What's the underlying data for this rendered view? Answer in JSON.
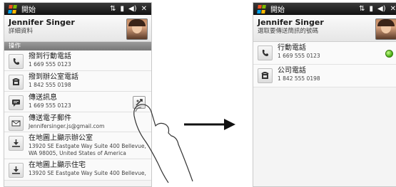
{
  "left_phone": {
    "status_title": "開始",
    "contact_name": "Jennifer Singer",
    "contact_sub": "詳細資料",
    "section": "操作",
    "items": [
      {
        "icon": "mobile-phone-icon",
        "label": "撥到行動電話",
        "detail": "1 669 555 0123"
      },
      {
        "icon": "office-phone-icon",
        "label": "撥到辦公室電話",
        "detail": "1 842 555 0198"
      },
      {
        "icon": "message-icon",
        "label": "傳送訊息",
        "detail": "1 669 555 0123"
      },
      {
        "icon": "email-icon",
        "label": "傳送電子郵件",
        "detail": "Jennifersinger.js@gmail.com"
      },
      {
        "icon": "map-icon",
        "label": "在地圖上顯示辦公室",
        "detail": "13920 SE Eastgate Way Suite 400 Bellevue, WA  98005, United States of America"
      },
      {
        "icon": "map-icon",
        "label": "在地圖上顯示住宅",
        "detail": "13920 SE Eastgate Way Suite 400 Bellevue,"
      }
    ]
  },
  "right_phone": {
    "status_title": "開始",
    "contact_name": "Jennifer Singer",
    "contact_sub": "選取要傳送簡訊的號碼",
    "items": [
      {
        "icon": "mobile-phone-icon",
        "label": "行動電話",
        "detail": "1 669 555 0123"
      },
      {
        "icon": "office-phone-icon",
        "label": "公司電話",
        "detail": "1 842 555 0198"
      }
    ]
  }
}
